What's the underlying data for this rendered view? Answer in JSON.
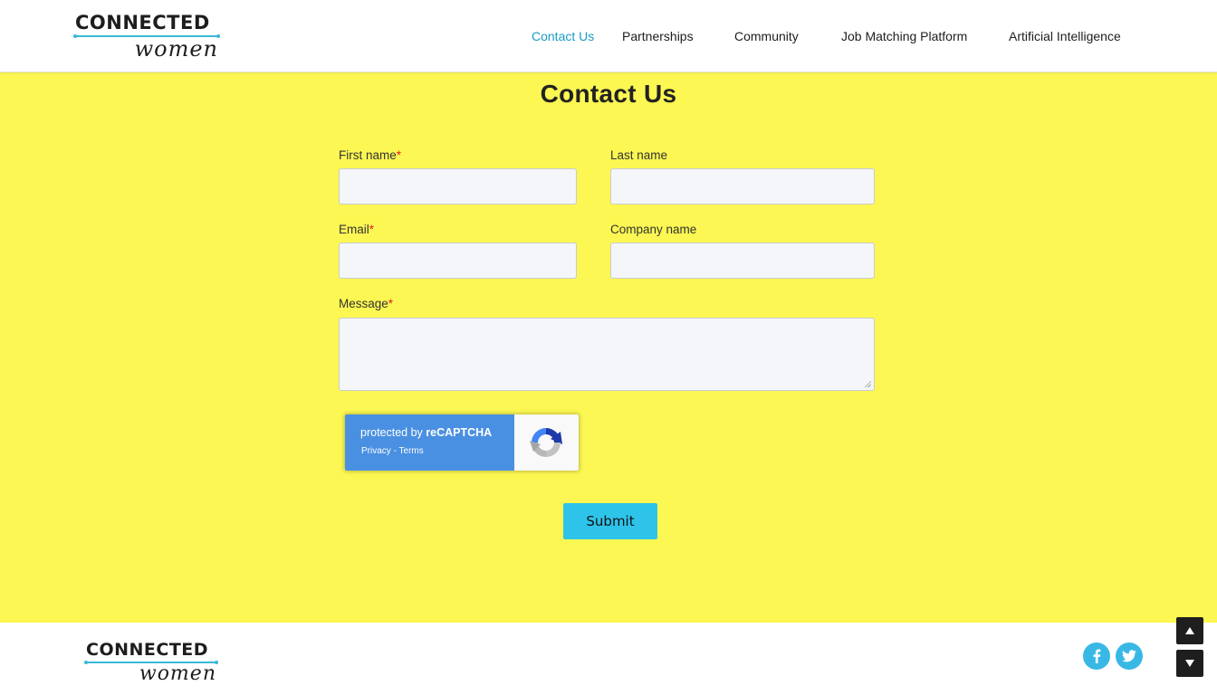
{
  "header": {
    "logo": {
      "top": "CONNECTED",
      "bottom": "women"
    },
    "nav": [
      {
        "label": "Contact Us",
        "active": true
      },
      {
        "label": "Partnerships",
        "active": false
      },
      {
        "label": "Community",
        "active": false
      },
      {
        "label": "Job Matching Platform",
        "active": false
      },
      {
        "label": "Artificial Intelligence",
        "active": false
      }
    ]
  },
  "main": {
    "title": "Contact Us",
    "form": {
      "first_name": {
        "label": "First name",
        "required_mark": "*",
        "value": ""
      },
      "last_name": {
        "label": "Last name",
        "value": ""
      },
      "email": {
        "label": "Email",
        "required_mark": "*",
        "value": ""
      },
      "company_name": {
        "label": "Company name",
        "value": ""
      },
      "message": {
        "label": "Message",
        "required_mark": "*",
        "value": ""
      },
      "recaptcha": {
        "protected_prefix": "protected by ",
        "brand": "reCAPTCHA",
        "privacy": "Privacy",
        "separator": " - ",
        "terms": "Terms"
      },
      "submit_label": "Submit"
    }
  },
  "footer": {
    "logo": {
      "top": "CONNECTED",
      "bottom": "women"
    },
    "social": [
      {
        "icon": "facebook-icon",
        "glyph": "f"
      },
      {
        "icon": "twitter-icon",
        "glyph": "t"
      }
    ],
    "scroll": [
      {
        "icon": "arrow-up-icon"
      },
      {
        "icon": "arrow-down-icon"
      }
    ]
  },
  "colors": {
    "accent": "#1a9bc4",
    "main_background": "#fcf752",
    "submit_button": "#2ec4ea",
    "required": "#e01f1f",
    "recaptcha_blue": "#4a90e2",
    "social": "#39b8e6"
  }
}
